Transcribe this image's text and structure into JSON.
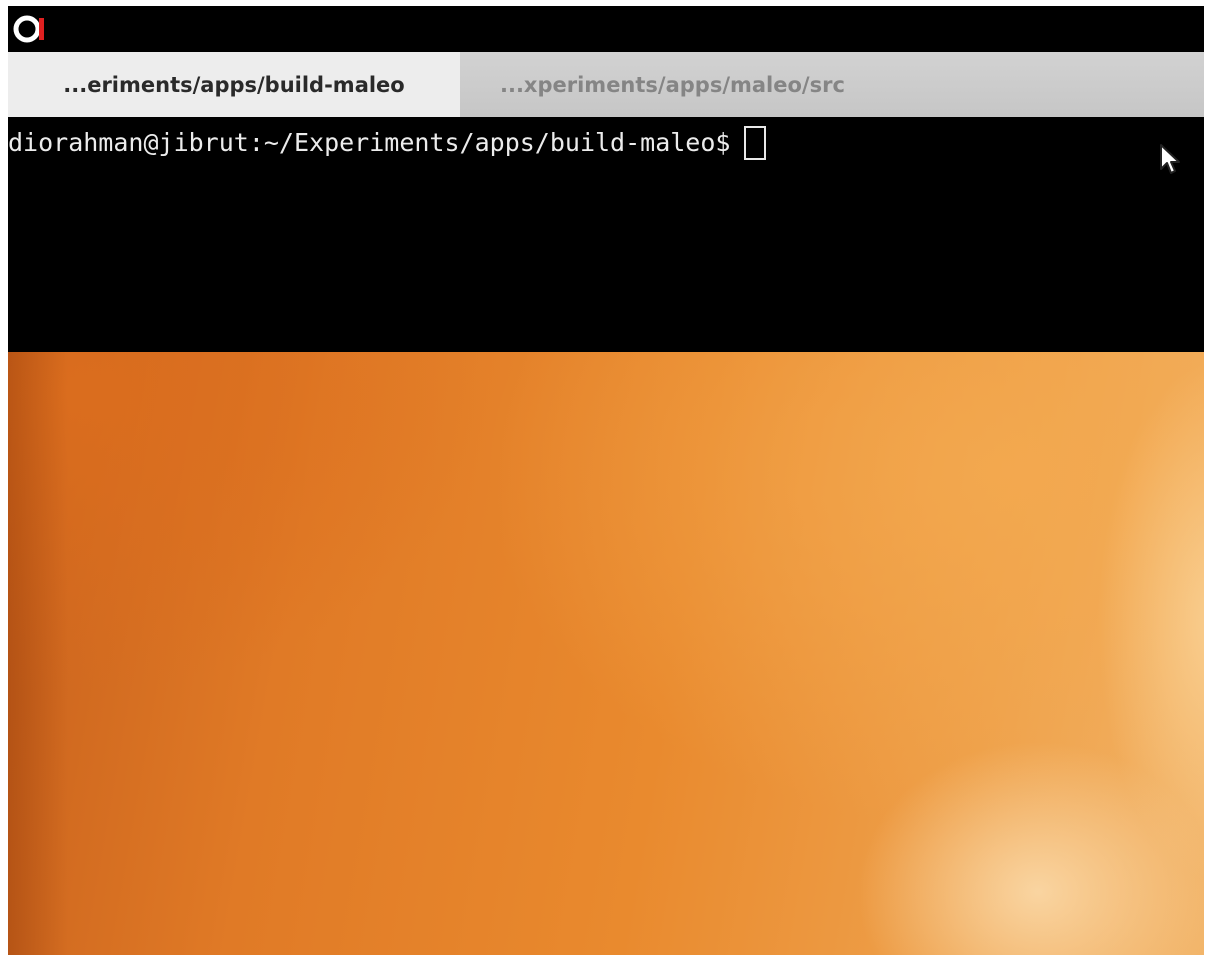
{
  "topbar": {
    "logo_icon": "app-logo-icon",
    "colors": {
      "background": "#000000",
      "logo_ring": "#ffffff",
      "logo_accent": "#e02020"
    }
  },
  "tabs": [
    {
      "label": "...eriments/apps/build-maleo",
      "active": true
    },
    {
      "label": "...xperiments/apps/maleo/src",
      "active": false
    }
  ],
  "terminal": {
    "prompt": "diorahman@jibrut:~/Experiments/apps/build-maleo$",
    "input": "",
    "colors": {
      "background": "#000000",
      "foreground": "#ececec"
    }
  },
  "desktop": {
    "wallpaper": "orange-gradient",
    "colors": {
      "dark": "#c8601c",
      "mid": "#e98a2e",
      "light": "#f2b56a"
    }
  },
  "pointer": {
    "icon": "mouse-pointer-icon"
  }
}
